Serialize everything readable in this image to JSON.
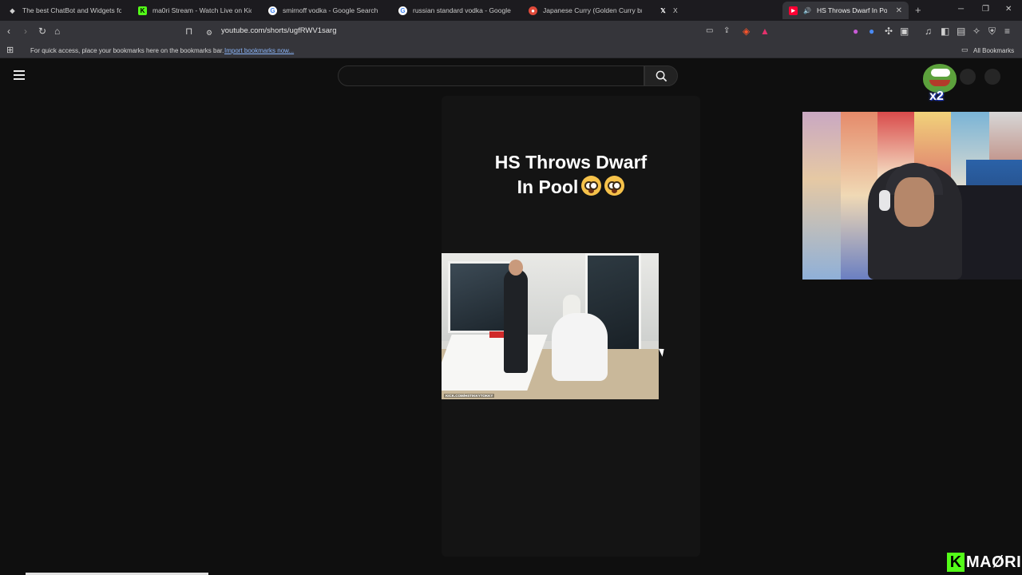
{
  "tabs": [
    {
      "title": "The best ChatBot and Widgets for Ki",
      "favicon": "chatbot-icon",
      "color": "#9b9b9b"
    },
    {
      "title": "ma0ri Stream - Watch Live on Kick",
      "favicon": "kick-icon",
      "color": "#53fc18"
    },
    {
      "title": "smirnoff vodka - Google Search",
      "favicon": "google-icon",
      "color": "#ffffff"
    },
    {
      "title": "russian standard vodka - Google Sea",
      "favicon": "google-icon",
      "color": "#ffffff"
    },
    {
      "title": "Japanese Curry (Golden Curry brand",
      "favicon": "recipe-icon",
      "color": "#e04a3a"
    },
    {
      "title": "X",
      "favicon": "x-icon",
      "color": "#ffffff"
    },
    {
      "title": "HS Throws Dwarf In Pool 😳",
      "favicon": "youtube-icon",
      "color": "#ff0033"
    }
  ],
  "address_bar": {
    "url": "youtube.com/shorts/ugfRWV1sarg"
  },
  "bookmarks_bar": {
    "hint": "For quick access, place your bookmarks here on the bookmarks bar.",
    "import_link": "Import bookmarks now...",
    "all_bookmarks": "All Bookmarks"
  },
  "youtube": {
    "search": {
      "placeholder": ""
    },
    "short": {
      "title_line1": "HS Throws Dwarf",
      "title_line2": "In Pool",
      "video_watermark": "KICK.COM/HSTIKKYTOKKY"
    }
  },
  "overlay": {
    "emote_count": "x2",
    "kick_brand": "MAØRI"
  }
}
